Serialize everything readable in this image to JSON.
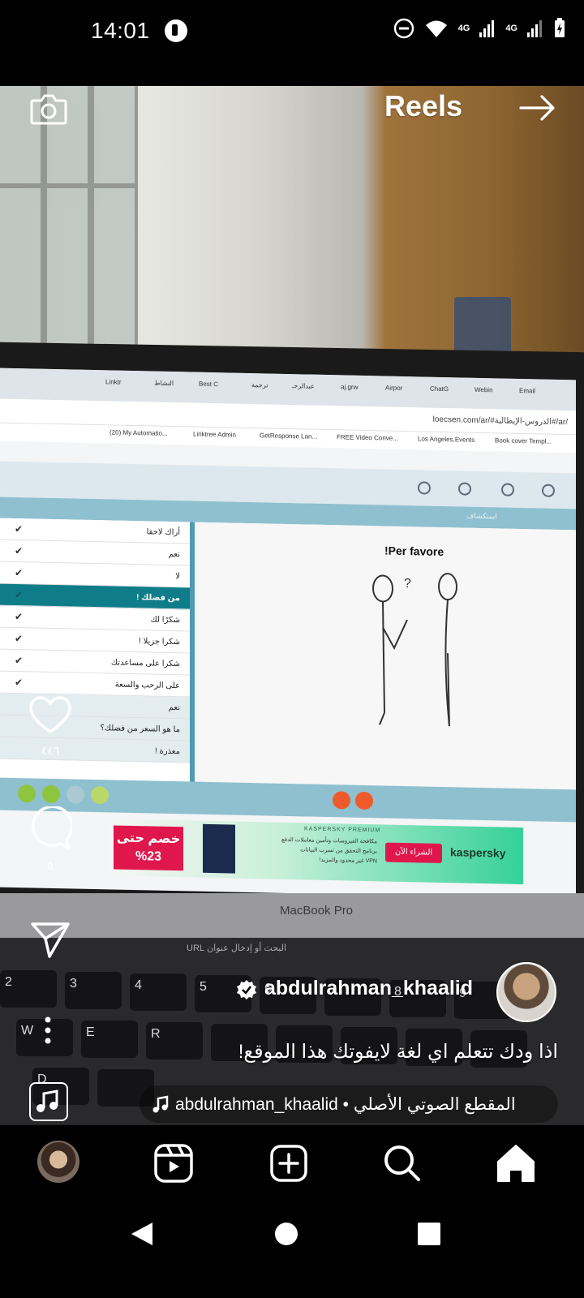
{
  "status_bar": {
    "time": "14:01",
    "network1": "4G",
    "network2": "4G"
  },
  "header": {
    "title": "Reels"
  },
  "screen_content": {
    "tabs": [
      "Linktr",
      "النشاط",
      "Best C",
      "ترجمة",
      "عبدالرحـ",
      "aj.grw",
      "Airpor",
      "ChatG",
      "Webin",
      "Email"
    ],
    "url": "loecsen.com/ar/#الدروس-الإيطالية#/ar/",
    "bookmarks": [
      "(20) My Automatio...",
      "Linktree Admin",
      "GetResponse Lan...",
      "FREE Video Conve...",
      "Los Angeles,Events",
      "Book cover Templ..."
    ],
    "site_sub_label": "استكشاف",
    "lesson_title": "!Per favore",
    "phrase_list": [
      {
        "text": "أراك لاحقا",
        "active": false
      },
      {
        "text": "نعم",
        "active": false
      },
      {
        "text": "لا",
        "active": false
      },
      {
        "text": "من فضلك !",
        "active": true
      },
      {
        "text": "شكرًا لك",
        "active": false
      },
      {
        "text": "شكرا جزيلا !",
        "active": false
      },
      {
        "text": "شكرا على مساعدتك",
        "active": false
      },
      {
        "text": "على الرحب والسعة",
        "active": false
      },
      {
        "text": "نعم",
        "active": false
      },
      {
        "text": "ما هو السعر من فضلك؟",
        "active": false
      },
      {
        "text": "معذرة !",
        "active": false
      }
    ],
    "ad": {
      "discount": "خصم حتى",
      "discount_value": "%23",
      "brand_label": "KASPERSKY PREMIUM",
      "bullets": [
        "مكافحة الفيروسات وتأمين معاملات الدفع",
        "برنامج التحقق من تسرب البيانات",
        "VPN غير محدود والمزيد!"
      ],
      "cta": "الشراء الآن",
      "brand": "kaspersky"
    },
    "laptop_label": "MacBook Pro",
    "touchbar_text": "البحث أو إدخال عنوان URL"
  },
  "actions": {
    "likes": "٤٤٦",
    "comments": "٥"
  },
  "post": {
    "username": "abdulrahman_khaalid",
    "caption": "اذا ودك تتعلم اي لغة لايفوتك هذا الموقع!",
    "audio": "abdulrahman_khaalid • المقطع الصوتي الأصلي"
  },
  "colors": {
    "accent_red": "#ff3040",
    "teal": "#0e7c89"
  }
}
